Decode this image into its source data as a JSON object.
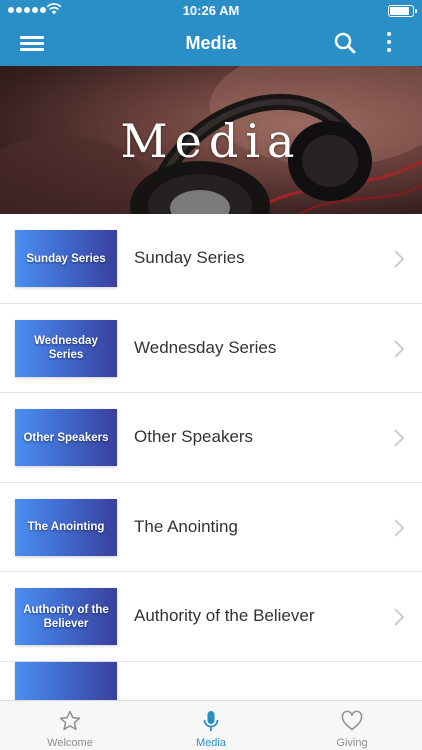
{
  "status_bar": {
    "time": "10:26 AM"
  },
  "nav": {
    "title": "Media"
  },
  "hero": {
    "title": "Media"
  },
  "items": [
    {
      "thumb": "Sunday Series",
      "label": "Sunday Series"
    },
    {
      "thumb": "Wednesday Series",
      "label": "Wednesday Series"
    },
    {
      "thumb": "Other Speakers",
      "label": "Other Speakers"
    },
    {
      "thumb": "The Anointing",
      "label": "The Anointing"
    },
    {
      "thumb": "Authority of the Believer",
      "label": "Authority of the Believer"
    }
  ],
  "tabs": [
    {
      "label": "Welcome",
      "icon": "star-icon",
      "active": false
    },
    {
      "label": "Media",
      "icon": "microphone-icon",
      "active": true
    },
    {
      "label": "Giving",
      "icon": "heart-icon",
      "active": false
    }
  ],
  "colors": {
    "accent": "#2a8fc7",
    "thumb_start": "#4a8ff2",
    "thumb_end": "#3a3f9c"
  }
}
